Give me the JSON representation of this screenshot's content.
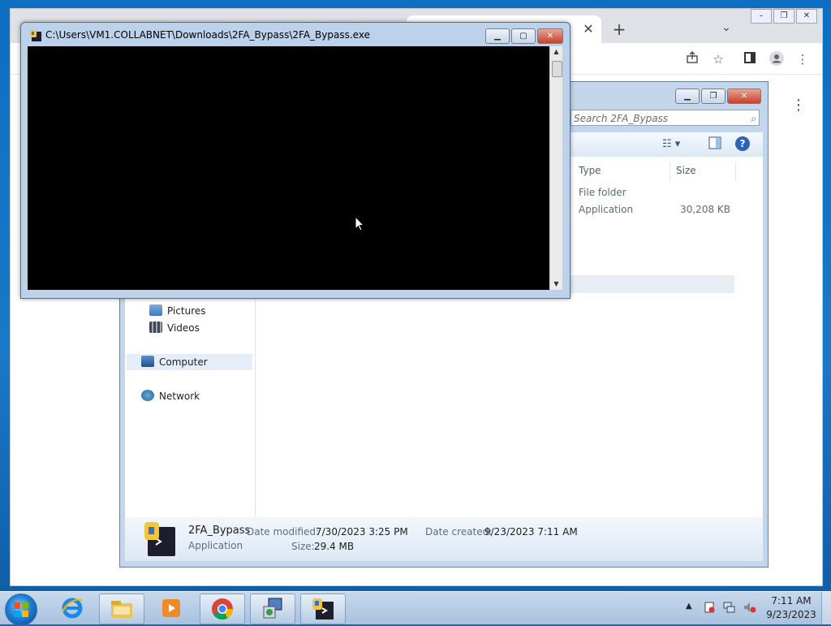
{
  "browser": {
    "tab_close": "✕",
    "new_tab": "+",
    "tab_search": "⌄",
    "icons": [
      "share-icon",
      "star-icon",
      "sidepanel-icon",
      "profile-icon",
      "menu-icon"
    ]
  },
  "console": {
    "title": "C:\\Users\\VM1.COLLABNET\\Downloads\\2FA_Bypass\\2FA_Bypass.exe"
  },
  "explorer": {
    "search_placeholder": "Search 2FA_Bypass",
    "columns": {
      "type": "Type",
      "size": "Size"
    },
    "files": [
      {
        "type": "File folder",
        "size": ""
      },
      {
        "type": "Application",
        "size": "30,208 KB"
      }
    ],
    "nav": {
      "pictures": "Pictures",
      "videos": "Videos",
      "computer": "Computer",
      "network": "Network"
    },
    "details": {
      "name": "2FA_Bypass",
      "type": "Application",
      "modified_label": "Date modified:",
      "modified_value": "7/30/2023 3:25 PM",
      "size_label": "Size:",
      "size_value": "29.4 MB",
      "created_label": "Date created:",
      "created_value": "9/23/2023 7:11 AM"
    }
  },
  "taskbar": {
    "apps": [
      "internet-explorer",
      "windows-explorer",
      "media-player",
      "chrome",
      "network-setup",
      "2fa-bypass"
    ],
    "clock_time": "7:11 AM",
    "clock_date": "9/23/2023"
  },
  "colors": {
    "desktop": "#1a78c8",
    "console_bg": "#000000",
    "selected_row": "#e9eef4"
  }
}
